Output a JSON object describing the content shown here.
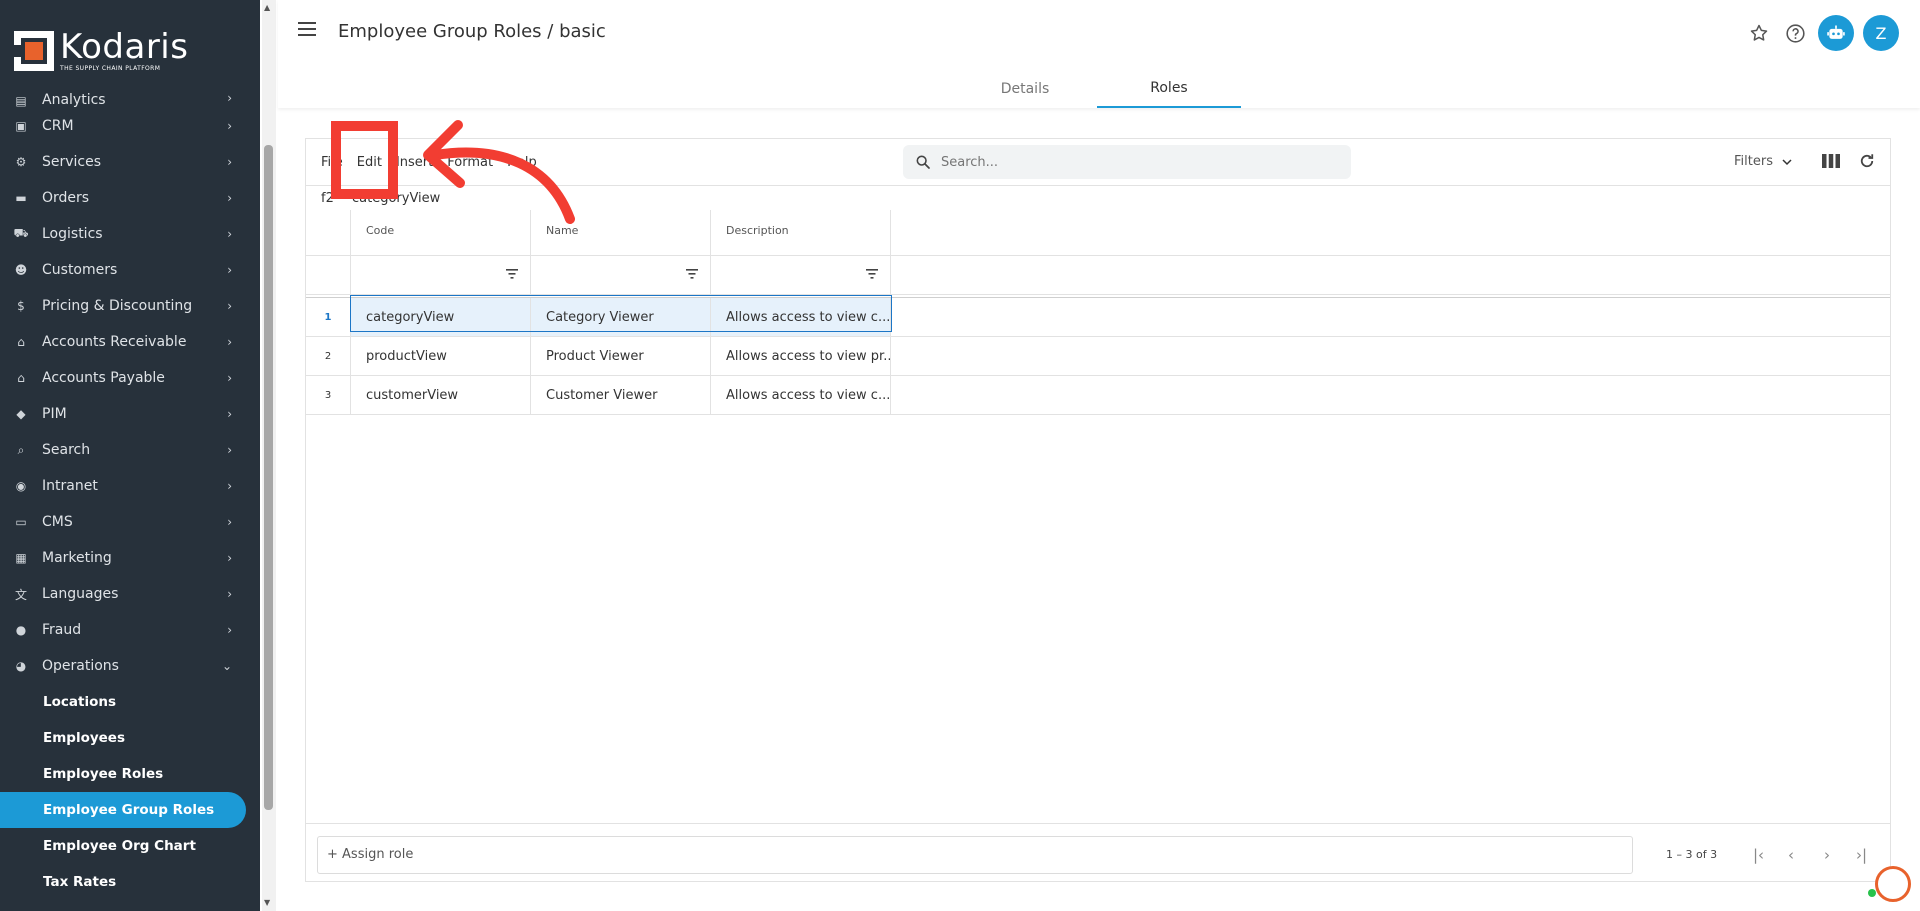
{
  "brand": {
    "name": "Kodaris",
    "tagline": "THE SUPPLY CHAIN PLATFORM"
  },
  "sidebar": {
    "items": [
      {
        "label": "Analytics",
        "icon": "analytics-icon"
      },
      {
        "label": "CRM",
        "icon": "crm-icon"
      },
      {
        "label": "Services",
        "icon": "services-icon"
      },
      {
        "label": "Orders",
        "icon": "orders-icon"
      },
      {
        "label": "Logistics",
        "icon": "logistics-icon"
      },
      {
        "label": "Customers",
        "icon": "customers-icon"
      },
      {
        "label": "Pricing & Discounting",
        "icon": "dollar-icon"
      },
      {
        "label": "Accounts Receivable",
        "icon": "bank-icon"
      },
      {
        "label": "Accounts Payable",
        "icon": "bank-icon"
      },
      {
        "label": "PIM",
        "icon": "tag-icon"
      },
      {
        "label": "Search",
        "icon": "search-icon"
      },
      {
        "label": "Intranet",
        "icon": "intranet-icon"
      },
      {
        "label": "CMS",
        "icon": "cms-icon"
      },
      {
        "label": "Marketing",
        "icon": "marketing-icon"
      },
      {
        "label": "Languages",
        "icon": "translate-icon"
      },
      {
        "label": "Fraud",
        "icon": "alert-icon"
      },
      {
        "label": "Operations",
        "icon": "operations-icon"
      }
    ],
    "sub_items": [
      {
        "label": "Locations"
      },
      {
        "label": "Employees"
      },
      {
        "label": "Employee Roles"
      },
      {
        "label": "Employee Group Roles"
      },
      {
        "label": "Employee Org Chart"
      },
      {
        "label": "Tax Rates"
      }
    ],
    "active_sub": "Employee Group Roles"
  },
  "header": {
    "title": "Employee Group Roles / basic",
    "avatar_initial": "Z",
    "tabs": [
      {
        "label": "Details"
      },
      {
        "label": "Roles"
      }
    ],
    "active_tab": "Roles"
  },
  "toolbar": {
    "menus": [
      {
        "label": "File"
      },
      {
        "label": "Edit"
      },
      {
        "label": "Insert"
      },
      {
        "label": "Format"
      },
      {
        "label": "Help"
      }
    ],
    "search_placeholder": "Search...",
    "filters_label": "Filters"
  },
  "cellbar": {
    "ref": "f2",
    "value": "categoryView"
  },
  "grid": {
    "columns": [
      {
        "label": "Code"
      },
      {
        "label": "Name"
      },
      {
        "label": "Description"
      }
    ],
    "rows": [
      {
        "num": "1",
        "code": "categoryView",
        "name": "Category Viewer",
        "description": "Allows access to view c..."
      },
      {
        "num": "2",
        "code": "productView",
        "name": "Product Viewer",
        "description": "Allows access to view pr..."
      },
      {
        "num": "3",
        "code": "customerView",
        "name": "Customer Viewer",
        "description": "Allows access to view c..."
      }
    ],
    "selected_row": 1
  },
  "footer": {
    "assign_label": "+ Assign role",
    "page_info": "1 – 3 of 3"
  },
  "colors": {
    "accent": "#1c9ad6",
    "sidebar_bg": "#27313b",
    "annotation": "#f23d32"
  }
}
